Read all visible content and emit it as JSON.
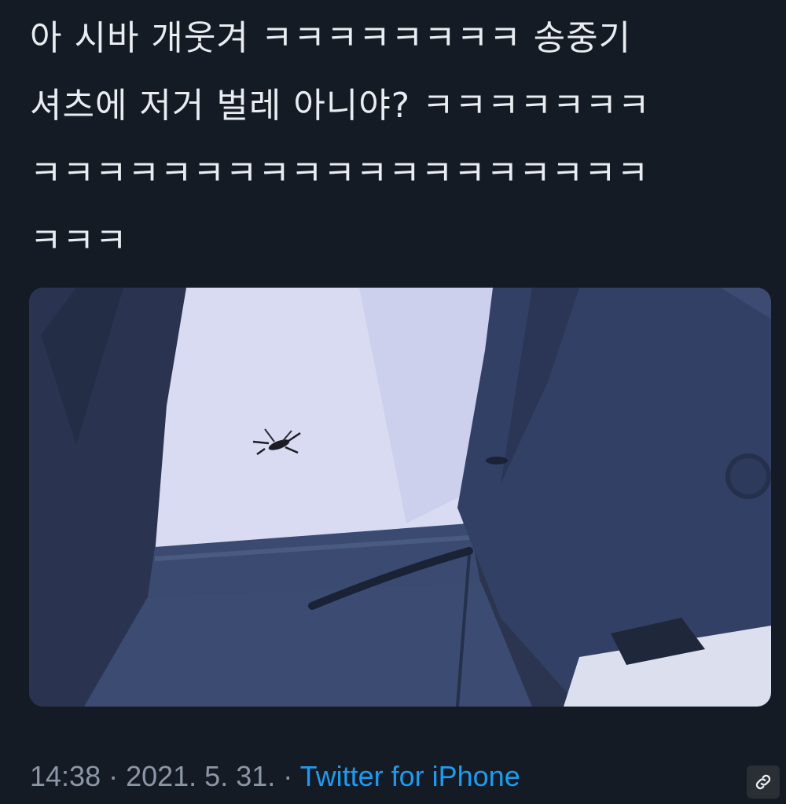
{
  "tweet": {
    "text": "아 시바 개웃겨 ㅋㅋㅋㅋㅋㅋㅋㅋ 송중기 셔츠에 저거 벌레 아니야? ㅋㅋㅋㅋㅋㅋㅋ ㅋㅋㅋㅋㅋㅋㅋㅋㅋㅋㅋㅋㅋㅋㅋㅋㅋㅋㅋ ㅋㅋㅋ",
    "timestamp": "14:38 · 2021. 5. 31.",
    "separator": " · ",
    "source": "Twitter for iPhone"
  },
  "media": {
    "icon": "photo-shirt-with-insect"
  },
  "icons": {
    "link": "link-icon"
  },
  "colors": {
    "background": "#151b25",
    "text": "#e9edf2",
    "meta": "#8b97a6",
    "source_link": "#1d9bf0"
  }
}
